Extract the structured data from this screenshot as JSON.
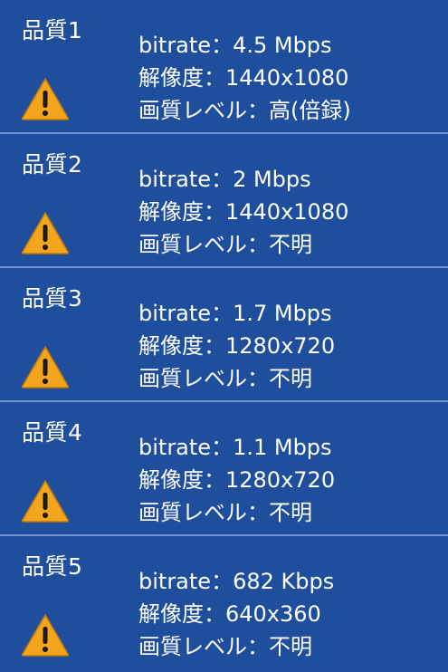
{
  "labels": {
    "bitrate": "bitrate：",
    "resolution": "解像度：",
    "quality_level": "画質レベル："
  },
  "icon": "warning-triangle-icon",
  "colors": {
    "background": "#1f4e9c",
    "divider": "#6f96d2",
    "text": "#ffffff",
    "warning_fill": "#f3a51e",
    "warning_mark": "#1a1a1a"
  },
  "items": [
    {
      "title": "品質1",
      "bitrate": "4.5 Mbps",
      "resolution": "1440x1080",
      "quality_level": "高(倍録)"
    },
    {
      "title": "品質2",
      "bitrate": "2 Mbps",
      "resolution": "1440x1080",
      "quality_level": "不明"
    },
    {
      "title": "品質3",
      "bitrate": "1.7 Mbps",
      "resolution": "1280x720",
      "quality_level": "不明"
    },
    {
      "title": "品質4",
      "bitrate": "1.1 Mbps",
      "resolution": "1280x720",
      "quality_level": "不明"
    },
    {
      "title": "品質5",
      "bitrate": "682 Kbps",
      "resolution": "640x360",
      "quality_level": "不明"
    }
  ]
}
